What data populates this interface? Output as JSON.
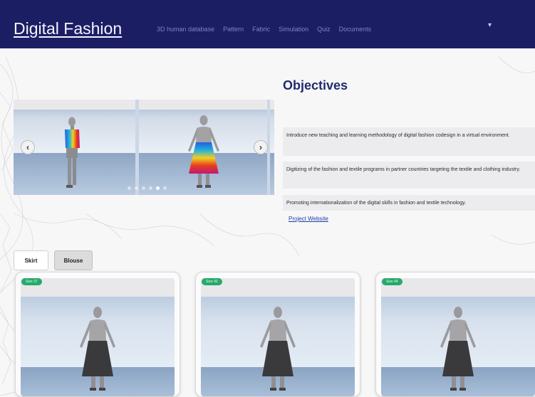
{
  "navbar": {
    "brand": "Digital Fashion",
    "links": [
      "3D human database",
      "Pattern",
      "Fabric",
      "Simulation",
      "Quiz",
      "Documents"
    ],
    "caret": "▾"
  },
  "carousel": {
    "prev_icon": "‹",
    "next_icon": "›",
    "slide_count": 6,
    "active_slide": 4
  },
  "objectives": {
    "title": "Objectives",
    "items": [
      "Introduce new teaching and learning methodology of digital fashion codesign in a virtual environment.",
      "Digitizing of the fashion and textile programs in partner countries targeting the textile and clothing industry.",
      "Promoting internationalization of the digital skills in fashion and textile technology."
    ],
    "project_link": "Project Website"
  },
  "tabs": {
    "skirt": "Skirt",
    "blouse": "Blouse",
    "active": "Skirt"
  },
  "cards": [
    {
      "size": "Size 37",
      "garment": "skirt"
    },
    {
      "size": "Size 42",
      "garment": "skirt"
    },
    {
      "size": "Size 44",
      "garment": "skirt"
    }
  ],
  "colors": {
    "navbar_bg": "#1c1e63",
    "title": "#1f2b6e",
    "badge": "#27a96b",
    "link": "#1b3fa8"
  }
}
